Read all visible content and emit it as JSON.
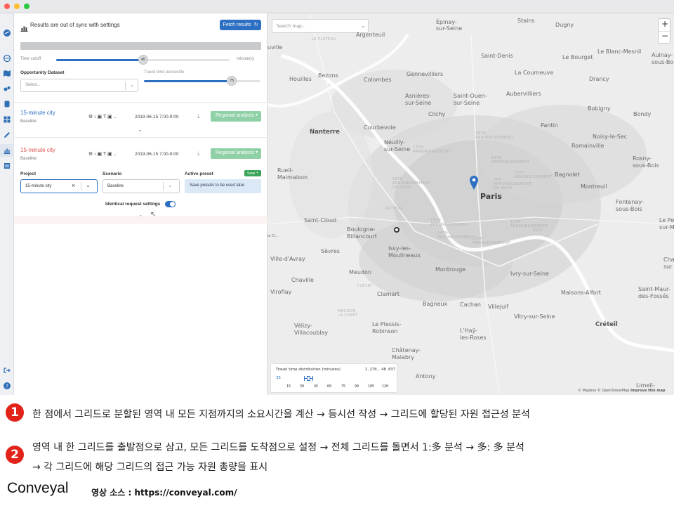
{
  "panel": {
    "header_title": "Results are out of sync with settings",
    "fetch_button": "Fetch results",
    "time_cutoff_label": "Time cutoff",
    "time_cutoff_value": "45",
    "time_cutoff_unit": "minute(s)",
    "time_cutoff_fraction": 0.5,
    "opportunity_label": "Opportunity Dataset",
    "opportunity_placeholder": "Select...",
    "percentile_label": "Travel time percentile",
    "percentile_value": "75",
    "percentile_fraction": 0.75,
    "result1": {
      "name": "15-minute city",
      "scenario": "Baseline",
      "date": "2019-06-15  7:00-9:00",
      "action": "Regional analysis"
    },
    "result2": {
      "name": "15-minute city",
      "scenario": "Baseline",
      "date": "2019-06-15  7:00-9:00",
      "action": "Regional analysis"
    },
    "mode_icons": "⚙ › ▣ T ▣ ..",
    "project_label": "Project",
    "project_value": "15-minute city",
    "scenario_label": "Scenario",
    "scenario_value": "Baseline",
    "preset_label": "Active preset",
    "preset_save": "Save",
    "preset_note": "Save presets to be used later.",
    "identical_label": "Identical request settings",
    "identical_on": true
  },
  "map": {
    "search_placeholder": "Search map...",
    "zoom_in": "+",
    "zoom_out": "−",
    "attribution_1": "© Mapbox",
    "attribution_2": "© OpenStreetMap",
    "attribution_3": "Improve this map",
    "places": {
      "argenteuil": "Argenteuil",
      "stains": "Stains",
      "dugny": "Dugny",
      "epinay": "Épinay-\nsur-Seine",
      "le_plateau": "LE PLATEAU",
      "villeneuve": "uville",
      "saint_denis": "Saint-Denis",
      "le_bourget": "Le Bourget",
      "blanc_mesnil": "Le Blanc-Mesnil",
      "aulnay": "Aulnay-\nsous-Bois",
      "la_courneuve": "La Courneuve",
      "drancy": "Drancy",
      "houilles": "Houilles",
      "bezons": "Bezons",
      "gennevilliers": "Gennevilliers",
      "colombes": "Colombes",
      "aubervilliers": "Aubervilliers",
      "asnieres": "Asnières-\nsur-Seine",
      "saint_ouen": "Saint-Ouen-\nsur-Seine",
      "clichy": "Clichy",
      "bobigny": "Bobigny",
      "bondy": "Bondy",
      "pantin": "Pantin",
      "nanterre": "Nanterre",
      "courbevoie": "Courbevoie",
      "noisy": "Noisy-le-Sec",
      "romainville": "Romainville",
      "neuilly": "Neuilly-\nsur-Seine",
      "rosny": "Rosny-\nsous-Bois",
      "rueil": "Rueil-\nMalmaison",
      "bagnolet": "Bagnolet",
      "montreuil": "Montreuil",
      "paris": "Paris",
      "fontenay": "Fontenay-\nsous-Bois",
      "saint_cloud": "Saint-Cloud",
      "le_perreux": "Le Per\nsur-M",
      "boulogne": "Boulogne-\nBillancourt",
      "vincennes": "Vincennes",
      "issy": "Issy-les-\nMoulineaux",
      "sevres": "Sèvres",
      "ville_davray": "Ville-d'Avray",
      "chaville": "Chaville",
      "meudon": "Meudon",
      "montrouge": "Montrouge",
      "ivry": "Ivry-sur-Seine",
      "champigny": "Cha\nsur",
      "viroflay": "Viroflay",
      "clamart": "Clamart",
      "maisons_alfort": "Maisons-Alfort",
      "saint_maur": "Saint-Maur-\ndes-Fossés",
      "bagneux": "Bagneux",
      "cachan": "Cachan",
      "villejuif": "Villejuif",
      "vitry": "Vitry-sur-Seine",
      "velizy": "Vélizy-\nVillacoublay",
      "plessis": "Le Plessis-\nRobinson",
      "lhay": "L'Haÿ-\nles-Roses",
      "creteil": "Créteil",
      "chatenay": "Châtenay-\nMalabry",
      "antony": "Antony",
      "limeil": "Limeil-",
      "fleury": "FLEURY",
      "meudon_foret": "MEUDON-\nLA-FORÊT",
      "la_cloud": "la Cl...",
      "arr_18": "18TH\nARRONDISSEMENT",
      "arr_17": "17TH\nARRONDISSEMENT",
      "arr_19": "19TH\nARRONDISSEMENT",
      "arr_16": "16TH\nARRONDISSEMENT\nDE PARIS",
      "arr_20": "20TH\nARRONDISSEMENT",
      "arr_3": "3RD\nARRONDISSEMENT\nDE PARIS",
      "arr_15": "15TH\nARRONDISSEMENT",
      "arr_12": "12TH\nARRONDISSEMENT",
      "arr_14": "14TH\nARRONDISSEMENT",
      "arr_13": "13TH\nARRONDISSEMENT",
      "auteuil": "AUTEUIL",
      "bois": "BOIS"
    },
    "histogram": {
      "title": "Travel time distribution (minutes)",
      "coords": "2.270, 48.837",
      "marker_label": "35",
      "ticks": [
        "15",
        "30",
        "45",
        "60",
        "75",
        "90",
        "105",
        "120"
      ]
    }
  },
  "caption": {
    "badge1": "1",
    "line1": "한 점에서 그리드로 분할된 영역 내 모든 지점까지의 소요시간을 계산 → 등시선 작성 → 그리드에 할당된 자원 접근성 분석",
    "badge2": "2",
    "line2a": "영역 내 한 그리드를 출발점으로 삼고, 모든 그리드를 도착점으로 설정 → 전체 그리드를 돌면서 1:多 분석 → 多: 多 분석",
    "line2b": "→ 각 그리드에 해당 그리드의 접근 가능 자원 총량을 표시",
    "brand": "Conveyal",
    "source": "영상 소스 : https://conveyal.com/"
  },
  "colors": {
    "accent": "#2d6fc2",
    "title_red": "#d9534f",
    "badge_red": "#e2231a",
    "green": "#8fd0a6"
  }
}
